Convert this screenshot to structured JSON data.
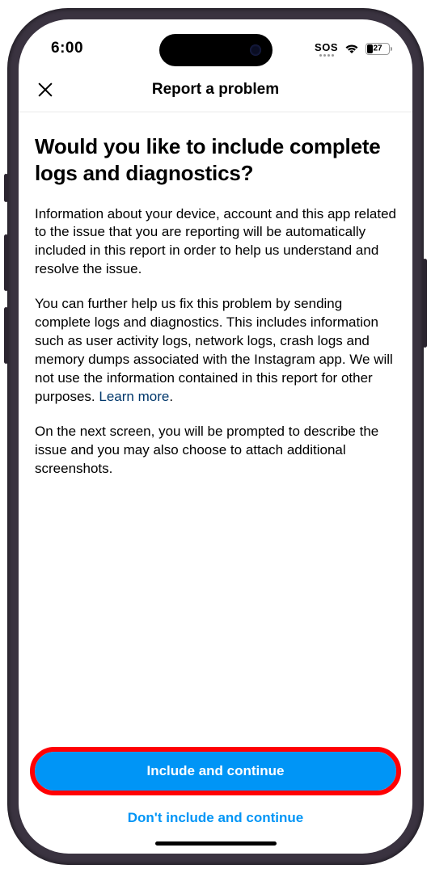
{
  "status_bar": {
    "time": "6:00",
    "sos": "SOS",
    "battery_pct": "27"
  },
  "nav": {
    "title": "Report a problem"
  },
  "content": {
    "heading": "Would you like to include complete logs and diagnostics?",
    "p1": "Information about your device, account and this app related to the issue that you are reporting will be automatically included in this report in order to help us understand and resolve the issue.",
    "p2a": "You can further help us fix this problem by sending complete logs and diagnostics. This includes information such as user activity logs, network logs, crash logs and memory dumps associated with the Instagram app. We will not use the information contained in this report for other purposes. ",
    "learn_more": "Learn more",
    "p2b": ".",
    "p3": "On the next screen, you will be prompted to describe the issue and you may also choose to attach additional screenshots."
  },
  "footer": {
    "primary": "Include and continue",
    "secondary": "Don't include and continue"
  }
}
